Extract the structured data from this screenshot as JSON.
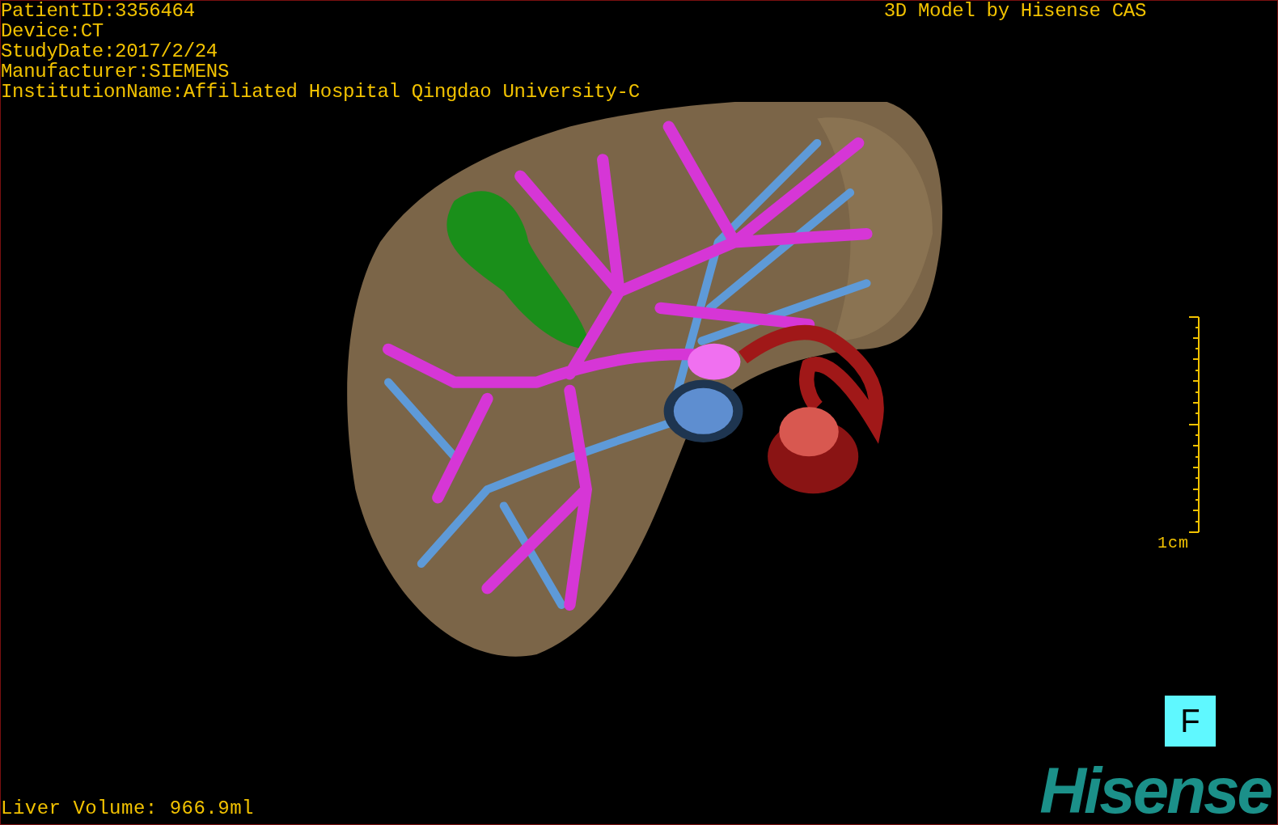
{
  "header": {
    "info_lines": [
      "PatientID:3356464",
      "Device:CT",
      "StudyDate:2017/2/24",
      "Manufacturer:SIEMENS",
      "InstitutionName:Affiliated Hospital Qingdao University-C"
    ],
    "title": "3D Model by Hisense CAS"
  },
  "scale": {
    "label": "1cm"
  },
  "view_orientation": "F",
  "measurement": "Liver Volume: 966.9ml",
  "logo": "Hisense"
}
